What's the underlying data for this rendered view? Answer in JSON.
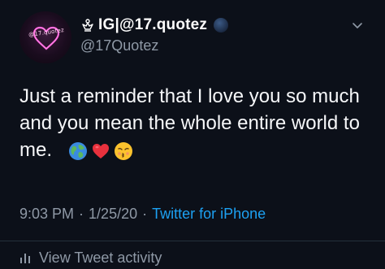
{
  "tweet": {
    "avatar_text": "@17.quotez",
    "display_name": "IG|@17.quotez",
    "username": "@17Quotez",
    "text": "Just a reminder that I love you so much\nand you mean the whole entire world to\nme.",
    "emojis": [
      "globe-emoji",
      "heart-emoji",
      "kissing-face-emoji"
    ],
    "time": "9:03 PM",
    "separator": "·",
    "date": "1/25/20",
    "source": "Twitter for iPhone",
    "activity_label": "View Tweet activity"
  },
  "colors": {
    "background": "#0c1019",
    "text_primary": "#f6f7f9",
    "text_secondary": "#8f99a6",
    "link": "#1da1f2",
    "divider": "#24303c"
  },
  "icons": {
    "crown": "crown-icon",
    "verified_globe": "globe-badge-icon",
    "menu": "chevron-down-icon",
    "activity": "bar-chart-icon"
  }
}
